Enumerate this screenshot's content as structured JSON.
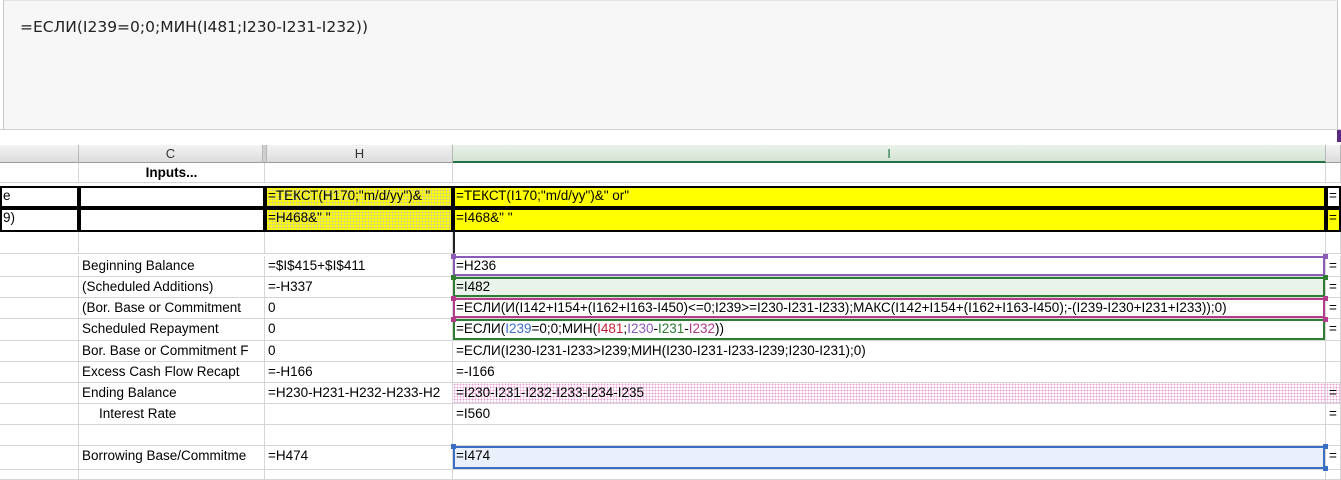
{
  "formula_bar": {
    "text": "=ЕСЛИ(I239=0;0;МИН(I481;I230-I231-I232))"
  },
  "columns": {
    "c": "C",
    "h": "H",
    "i": "I"
  },
  "rows": {
    "r0": {
      "c": "Inputs..."
    },
    "r1": {
      "left": "e",
      "h": "=ТЕКСТ(H170;\"m/d/yy\")& \"",
      "i": "=ТЕКСТ(I170;\"m/d/yy\")&\" or\"",
      "right": "="
    },
    "r2": {
      "left": "9)",
      "h": "=H468&\" \"",
      "i": "=I468&\" \"",
      "right": "="
    },
    "r4": {
      "c": "Beginning Balance",
      "h": "=$I$415+$I$411",
      "i": "=H236",
      "right": "="
    },
    "r5": {
      "c": "(Scheduled Additions)",
      "h": "=-H337",
      "i": "=I482",
      "right": "="
    },
    "r6": {
      "c": "(Bor. Base or Commitment",
      "h": "0",
      "i": "=ЕСЛИ(И(I142+I154+(I162+I163-I450)<=0;I239>=I230-I231-I233);МАКС(I142+I154+(I162+I163-I450);-(I239-I230+I231+I233));0)",
      "right": "="
    },
    "r7": {
      "c": "Scheduled Repayment",
      "h": "0",
      "right": "=",
      "i_parts": {
        "p1": "=ЕСЛИ(",
        "p2": "I239",
        "p3": "=0;0;МИН(",
        "p4": "I481",
        "p5": ";",
        "p6": "I230",
        "p7": "-",
        "p8": "I231",
        "p9": "-",
        "p10": "I232",
        "p11": "))"
      }
    },
    "r8": {
      "c": "Bor. Base or Commitment F",
      "h": "0",
      "i": "=ЕСЛИ(I230-I231-I233>I239;МИН(I230-I231-I233-I239;I230-I231);0)"
    },
    "r9": {
      "c": "Excess Cash Flow Recapt",
      "h": "=-H166",
      "i": "=-I166"
    },
    "r10": {
      "c": "Ending Balance",
      "h": "=H230-H231-H232-H233-H2",
      "i": "=I230-I231-I232-I233-I234-I235",
      "right": "="
    },
    "r11": {
      "c": "Interest Rate",
      "i": "=I560",
      "right": "="
    },
    "r13": {
      "c": "Borrowing Base/Commitme",
      "h": "=H474",
      "i": "=I474",
      "right": "="
    }
  },
  "colors": {
    "yellow": "#ffff00",
    "purple": "#8a5cb8",
    "green": "#2e7d32",
    "magenta": "#b23c8a",
    "blue": "#3a6fc4",
    "red": "#c2203a"
  }
}
